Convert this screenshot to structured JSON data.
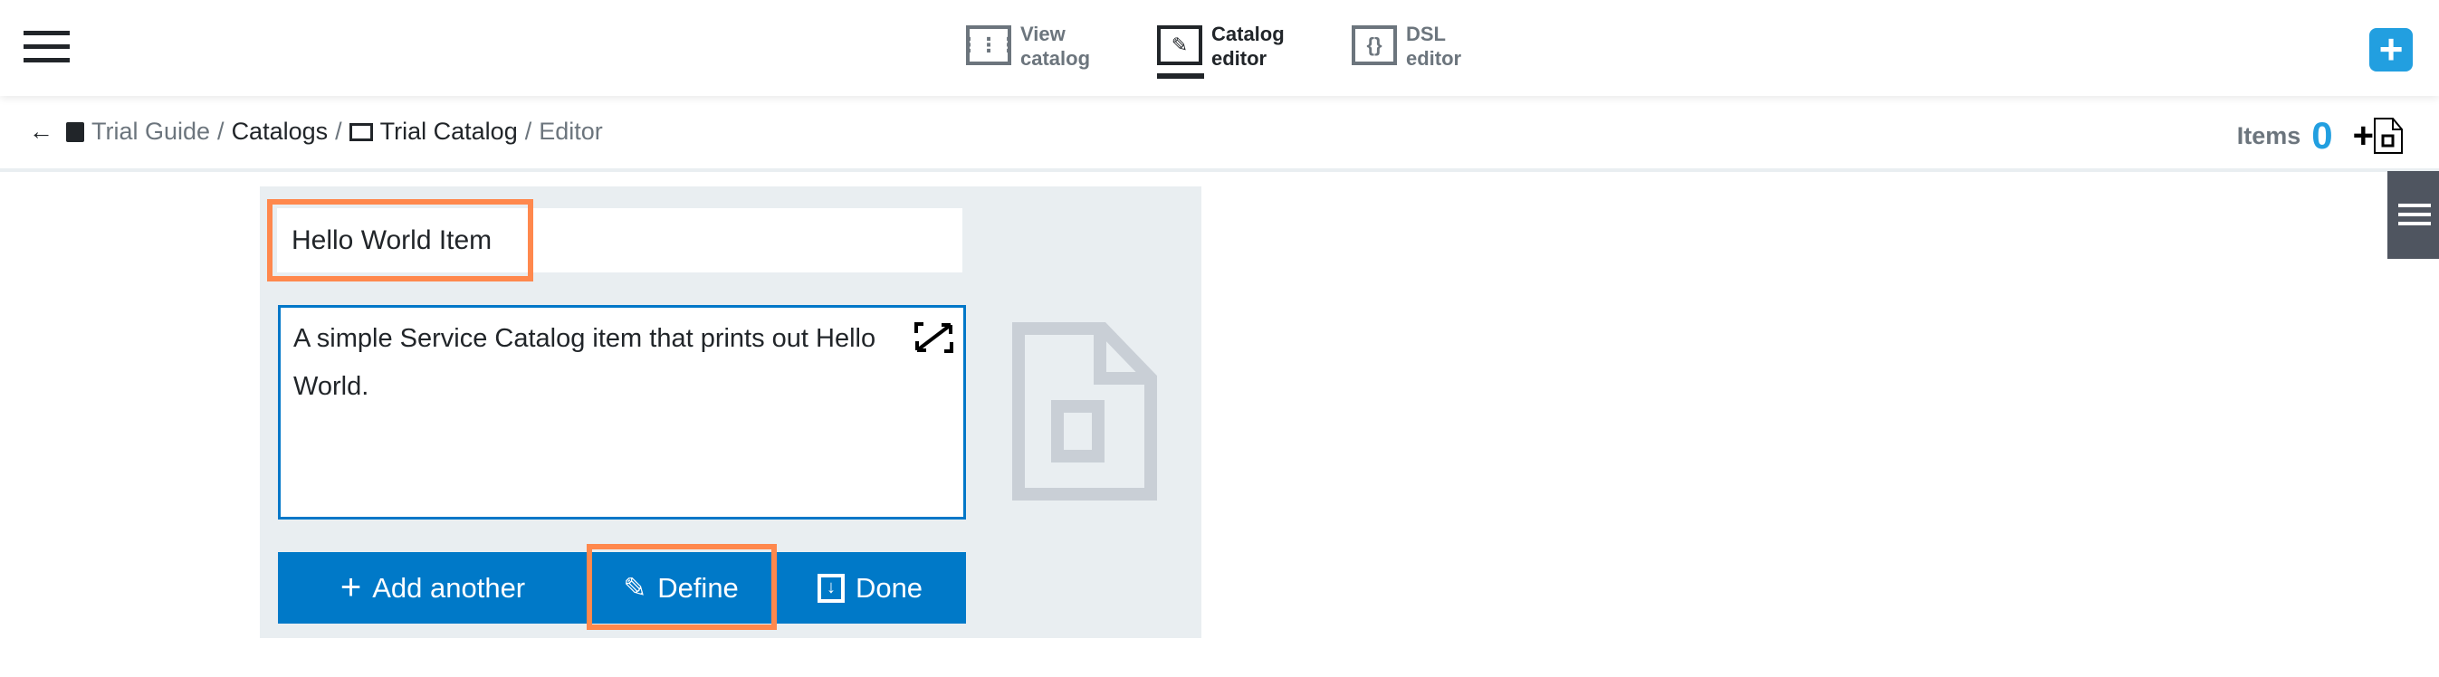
{
  "header": {
    "tabs": [
      {
        "line1": "View",
        "line2": "catalog",
        "icon": "grid-icon",
        "active": false
      },
      {
        "line1": "Catalog",
        "line2": "editor",
        "icon": "pencil-icon",
        "active": true
      },
      {
        "line1": "DSL",
        "line2": "editor",
        "icon": "braces-icon",
        "active": false
      }
    ],
    "add_icon": "plus-icon"
  },
  "breadcrumb": {
    "items": [
      "Trial Guide",
      "Catalogs",
      "Trial Catalog",
      "Editor"
    ],
    "separator": "/"
  },
  "items_counter": {
    "label": "Items",
    "count": "0",
    "add_symbol": "+"
  },
  "editor": {
    "title_value": "Hello World Item",
    "description_value": "A simple Service Catalog item that prints out Hello World.",
    "buttons": {
      "add_another": "Add another",
      "define": "Define",
      "done": "Done"
    }
  },
  "colors": {
    "accent": "#0079c8",
    "highlight": "#ff884d",
    "panel": "#e9eef1",
    "brand": "#229fe0"
  }
}
